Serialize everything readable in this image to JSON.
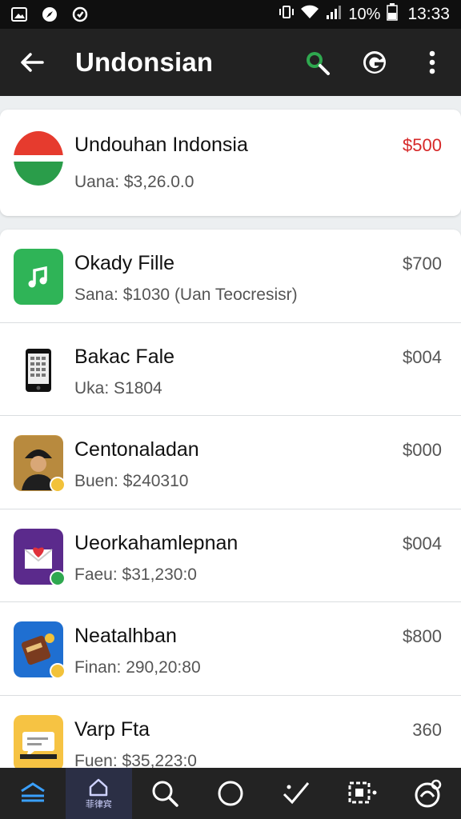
{
  "status_bar": {
    "battery": "10%",
    "time": "13:33"
  },
  "app_bar": {
    "title": "Undonsian"
  },
  "featured": {
    "title": "Undouhan Indonsia",
    "subtitle": "Uana: $3,26.0.0",
    "price": "$500",
    "price_color": "#d62828",
    "icon": "indonesia-flag-icon"
  },
  "items": [
    {
      "title": "Okady Fille",
      "subtitle": "Sana: $1030 (Uan Teocresisr)",
      "price": "$700",
      "icon": "music-note-icon"
    },
    {
      "title": "Bakac Fale",
      "subtitle": "Uka: S1804",
      "price": "$004",
      "icon": "phone-icon"
    },
    {
      "title": "Centonaladan",
      "subtitle": "Buen: $240310",
      "price": "$000",
      "icon": "person-photo-icon"
    },
    {
      "title": "Ueorkahamlepnan",
      "subtitle": "Faeu: $31,230:0",
      "price": "$004",
      "icon": "heart-mail-icon"
    },
    {
      "title": "Neatalhban",
      "subtitle": "Finan: 290,20:80",
      "price": "$800",
      "icon": "game-icon"
    },
    {
      "title": "Varp Fta",
      "subtitle": "Fuen: $35,223:0",
      "price": "360",
      "icon": "chat-icon"
    }
  ],
  "bottom_nav": {
    "active_label": "菲律宾"
  },
  "colors": {
    "app_bar_bg": "#222222",
    "accent_green": "#2fa84f",
    "accent_red": "#d62828"
  }
}
